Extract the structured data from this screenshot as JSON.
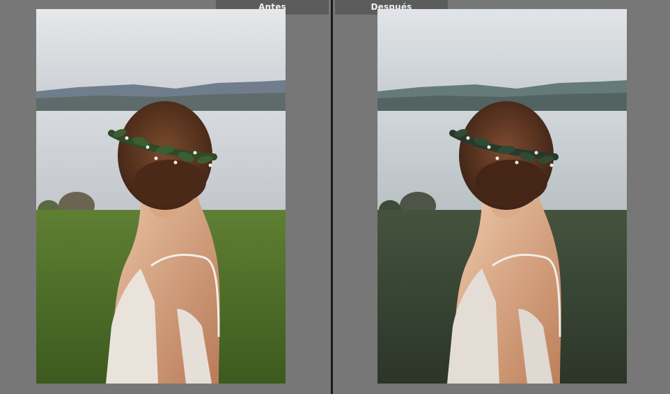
{
  "compare": {
    "before_label": "Antes",
    "after_label": "Después"
  },
  "colors": {
    "background": "#777777",
    "divider": "#1a1a1a",
    "label_bg": "#5c5c5c",
    "label_text": "#efefef"
  },
  "photos": {
    "before": {
      "icon": "bride-photo-original"
    },
    "after": {
      "icon": "bride-photo-edited"
    }
  }
}
